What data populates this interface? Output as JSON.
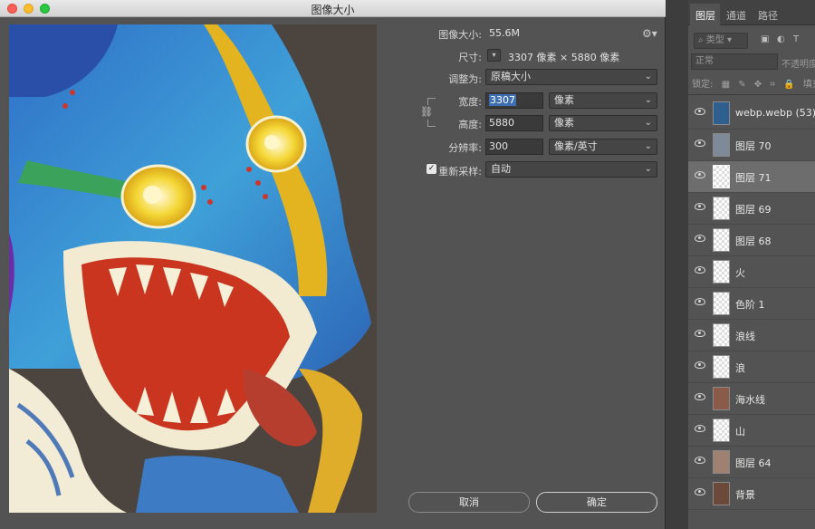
{
  "dialog": {
    "title": "图像大小",
    "image_size_label": "图像大小:",
    "image_size_value": "55.6M",
    "dimensions_label": "尺寸:",
    "dimensions_value": "3307 像素 × 5880 像素",
    "fit_to_label": "调整为:",
    "fit_to_value": "原稿大小",
    "width_label": "宽度:",
    "width_value": "3307",
    "width_unit": "像素",
    "height_label": "高度:",
    "height_value": "5880",
    "height_unit": "像素",
    "resolution_label": "分辨率:",
    "resolution_value": "300",
    "resolution_unit": "像素/英寸",
    "resample_label": "重新采样:",
    "resample_value": "自动",
    "resample_checked": true,
    "cancel_label": "取消",
    "ok_label": "确定"
  },
  "panel": {
    "tabs": [
      "图层",
      "通道",
      "路径"
    ],
    "filter_label": "类型",
    "blend_mode": "正常",
    "opacity_label": "不透明度",
    "lock_label": "锁定:",
    "fill_label": "填充",
    "layers": [
      {
        "name": "webp.webp (53)",
        "selected": false
      },
      {
        "name": "图层 70",
        "selected": false
      },
      {
        "name": "图层 71",
        "selected": true
      },
      {
        "name": "图层 69",
        "selected": false
      },
      {
        "name": "图层 68",
        "selected": false
      },
      {
        "name": "火",
        "selected": false
      },
      {
        "name": "色阶 1",
        "selected": false
      },
      {
        "name": "浪线",
        "selected": false
      },
      {
        "name": "浪",
        "selected": false
      },
      {
        "name": "海水线",
        "selected": false
      },
      {
        "name": "山",
        "selected": false
      },
      {
        "name": "图层 64",
        "selected": false
      },
      {
        "name": "背景",
        "selected": false
      }
    ]
  },
  "colors": {
    "dialog_bg": "#535353",
    "panel_bg": "#535353",
    "selection_bg": "#6d6d6d",
    "highlight": "#3e6fb5"
  }
}
